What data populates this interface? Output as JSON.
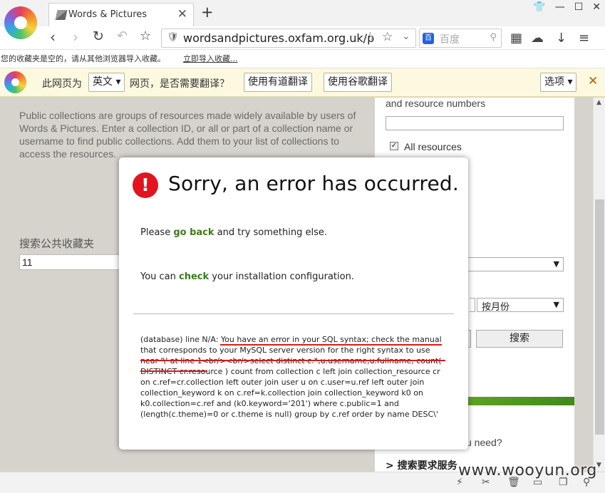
{
  "browser": {
    "tab_title": "Words & Pictures",
    "url": "wordsandpictures.oxfam.org.uk/p",
    "search_placeholder": "百度",
    "search_engine_icon_label": "百",
    "bookmarks_text": "您的收藏夹是空的，请从其他浏览器导入收藏。",
    "bookmarks_import_link": "立即导入收藏..."
  },
  "translate_bar": {
    "prefix": "此网页为",
    "language": "英文",
    "question": "网页，是否需要翻译？",
    "youdao_button": "使用有道翻译",
    "google_button": "使用谷歌翻译",
    "options_button": "选项"
  },
  "page": {
    "intro": "Public collections are groups of resources made widely available by users of Words & Pictures. Enter a collection ID, or all or part of a collection name or username to find public collections. Add them to your list of collections to access the resources.",
    "search_label": "搜索公共收藏夹",
    "search_value": "11",
    "right_partial": "and resource numbers",
    "all_resources": "All resources",
    "month_select": "按月份",
    "search_button": "搜索",
    "need_text": "u need?",
    "service_link": "> 搜索要求服务"
  },
  "dialog": {
    "title": "Sorry, an error has occurred.",
    "line1_prefix": "Please ",
    "line1_link": "go back",
    "line1_suffix": " and try something else.",
    "line2_prefix": "You can ",
    "line2_link": "check",
    "line2_suffix": " your installation configuration.",
    "error_text": "(database) line N/A: You have an error in your SQL syntax; check the manual that corresponds to your MySQL server version for the right syntax to use near '\\' at line 1<br/><br/>select distinct c.*,u.username,u.fullname, count( DISTINCT cr.resource ) count from collection c left join collection_resource cr on c.ref=cr.collection left outer join user u on c.user=u.ref left outer join collection_keyword k on c.ref=k.collection join collection_keyword k0 on k0.collection=c.ref and (k0.keyword='201') where c.public=1 and (length(c.theme)=0 or c.theme is null) group by c.ref order by name DESC\\'"
  },
  "watermark": "www.wooyun.org",
  "colors": {
    "error_red": "#e0151f",
    "link_green": "#3d7a1c",
    "annotation_red": "#d81c1c",
    "translate_bar_bg": "#fdf9e0"
  }
}
